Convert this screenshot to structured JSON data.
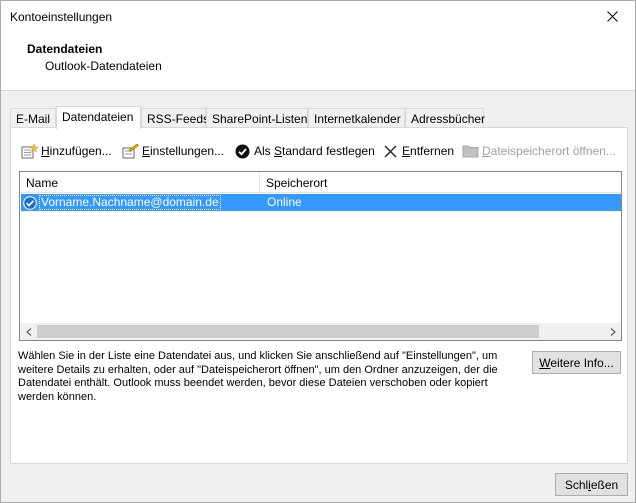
{
  "window": {
    "title": "Kontoeinstellungen"
  },
  "header": {
    "title": "Datendateien",
    "subtitle": "Outlook-Datendateien"
  },
  "tabs": [
    {
      "label": "E-Mail",
      "active": false
    },
    {
      "label": "Datendateien",
      "active": true
    },
    {
      "label": "RSS-Feeds",
      "active": false
    },
    {
      "label": "SharePoint-Listen",
      "active": false
    },
    {
      "label": "Internetkalender",
      "active": false
    },
    {
      "label": "Adressbücher",
      "active": false
    }
  ],
  "toolbar": {
    "add": {
      "pre": "",
      "key": "H",
      "post": "inzufügen..."
    },
    "settings": {
      "pre": "",
      "key": "E",
      "post": "instellungen..."
    },
    "default": {
      "pre": "Als ",
      "key": "S",
      "post": "tandard festlegen"
    },
    "remove": {
      "pre": "",
      "key": "E",
      "post": "ntfernen"
    },
    "open_location": {
      "pre": "",
      "key": "D",
      "post": "ateispeicherort öffnen..."
    }
  },
  "list": {
    "columns": [
      "Name",
      "Speicherort"
    ],
    "rows": [
      {
        "name": "Vorname.Nachname@domain.de",
        "location": "Online",
        "selected": true,
        "default": true
      }
    ]
  },
  "description": "Wählen Sie in der Liste eine Datendatei aus, und klicken Sie anschließend auf \"Einstellungen\", um weitere Details zu erhalten, oder auf \"Dateispeicherort öffnen\", um den Ordner anzuzeigen, der die Datendatei enthält. Outlook muss beendet werden, bevor diese Dateien verschoben oder kopiert werden können.",
  "buttons": {
    "more_info": {
      "key": "W",
      "post": "eitere Info..."
    },
    "close": {
      "pre": "Schl",
      "key": "i",
      "post": "eßen"
    }
  },
  "colors": {
    "selection": "#3399ff",
    "check_icon": "#1e6fc7"
  }
}
